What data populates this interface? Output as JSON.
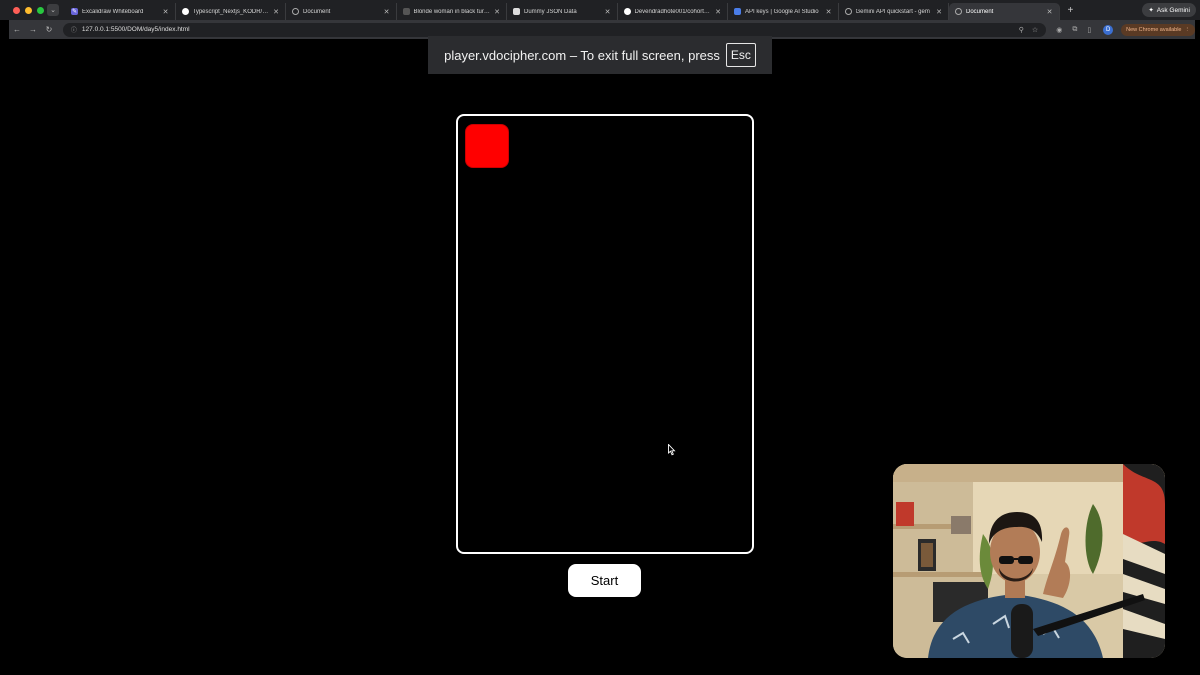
{
  "browser": {
    "tabs": [
      {
        "title": "Excalidraw Whiteboard",
        "icon": "excalidraw-icon",
        "active": false
      },
      {
        "title": "Typescript_Nextjs_KODR/rea",
        "icon": "github-icon",
        "active": false
      },
      {
        "title": "Document",
        "icon": "globe-icon",
        "active": false
      },
      {
        "title": "Blonde woman in black turtle",
        "icon": "image-icon",
        "active": false
      },
      {
        "title": "Dummy JSON Data",
        "icon": "json-icon",
        "active": false
      },
      {
        "title": "Devendradhote001/cohort3.0",
        "icon": "github-icon",
        "active": false
      },
      {
        "title": "API keys | Google AI Studio",
        "icon": "studio-icon",
        "active": false
      },
      {
        "title": "Gemini API quickstart - gem",
        "icon": "gemini-icon",
        "active": false
      },
      {
        "title": "Document",
        "icon": "globe-icon",
        "active": true
      }
    ],
    "ask_gemini": "Ask Gemini",
    "url": "127.0.0.1:5500/DOM/day5/index.html",
    "profile_initial": "D",
    "update_label": "New Chrome available"
  },
  "fullscreen_notice": {
    "text": "player.vdocipher.com – To exit full screen, press",
    "key": "Esc"
  },
  "game": {
    "start_label": "Start",
    "player_color": "#ff0000",
    "border_color": "#ffffff"
  }
}
